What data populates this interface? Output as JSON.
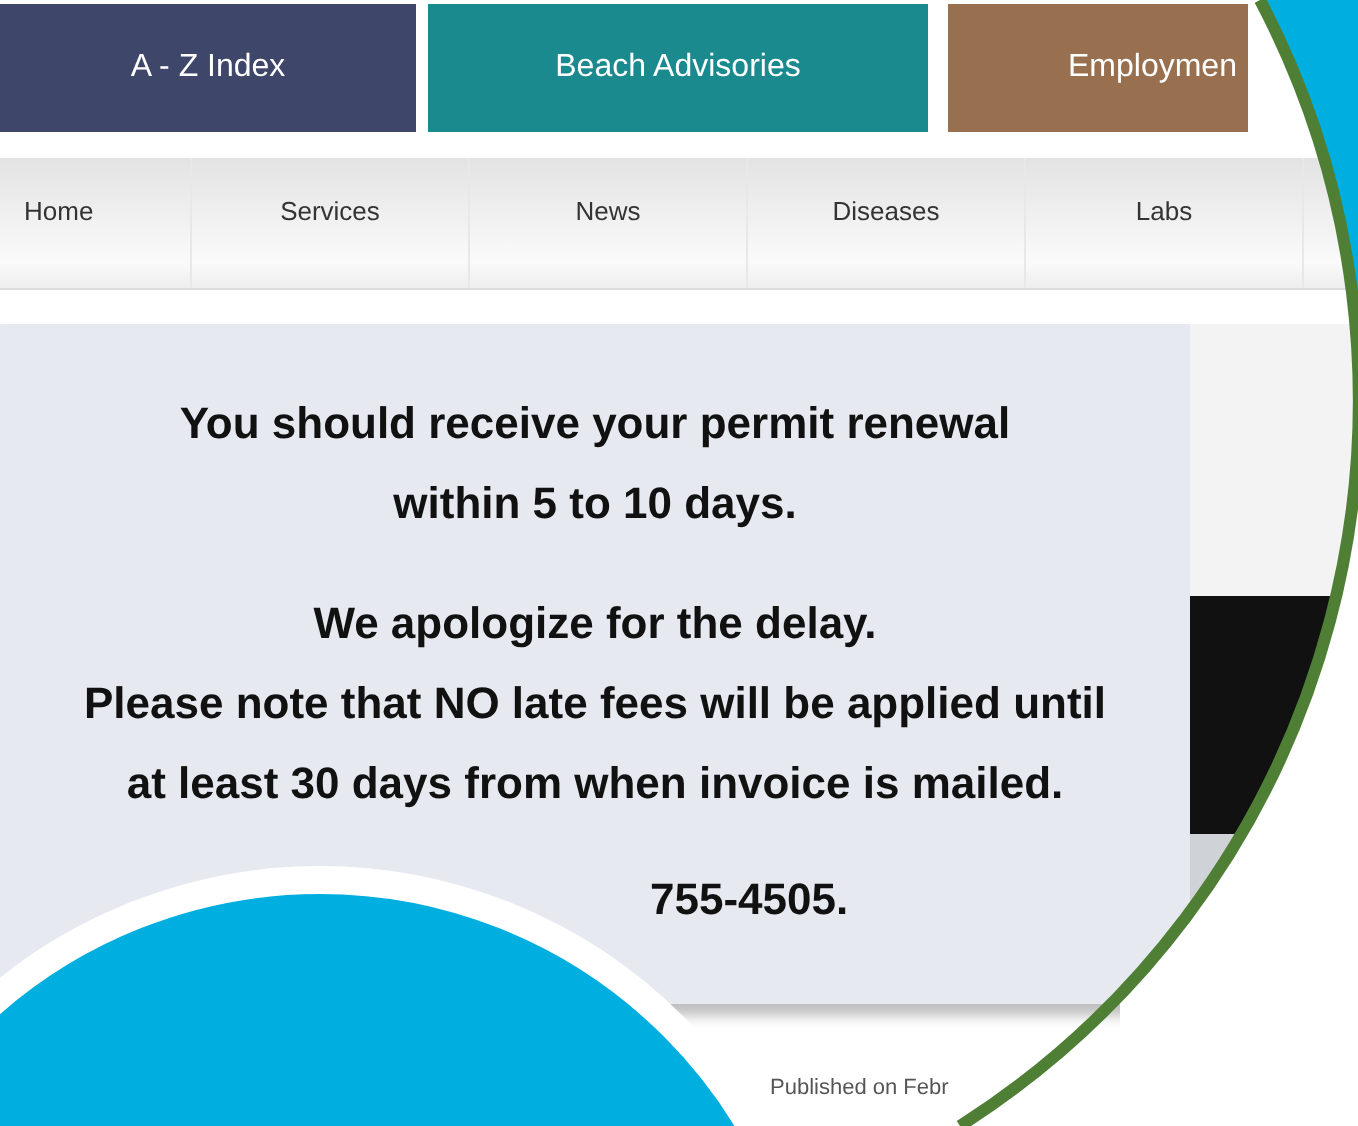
{
  "top_tiles": [
    {
      "label": "A - Z Index",
      "color": "#3e4669"
    },
    {
      "label": "Beach Advisories",
      "color": "#1a8a8f"
    },
    {
      "label": "Employmen",
      "color": "#98704f"
    }
  ],
  "nav": [
    {
      "label": "Home"
    },
    {
      "label": "Services"
    },
    {
      "label": "News"
    },
    {
      "label": "Diseases"
    },
    {
      "label": "Labs"
    }
  ],
  "banner": {
    "lines": [
      "You should receive your permit renewal",
      "within 5 to 10 days.",
      "We apologize for the delay.",
      "Please note that NO late fees will be applied until",
      "at least 30 days from when invoice is mailed."
    ],
    "phone": "755-4505."
  },
  "published": "Published on Febr"
}
